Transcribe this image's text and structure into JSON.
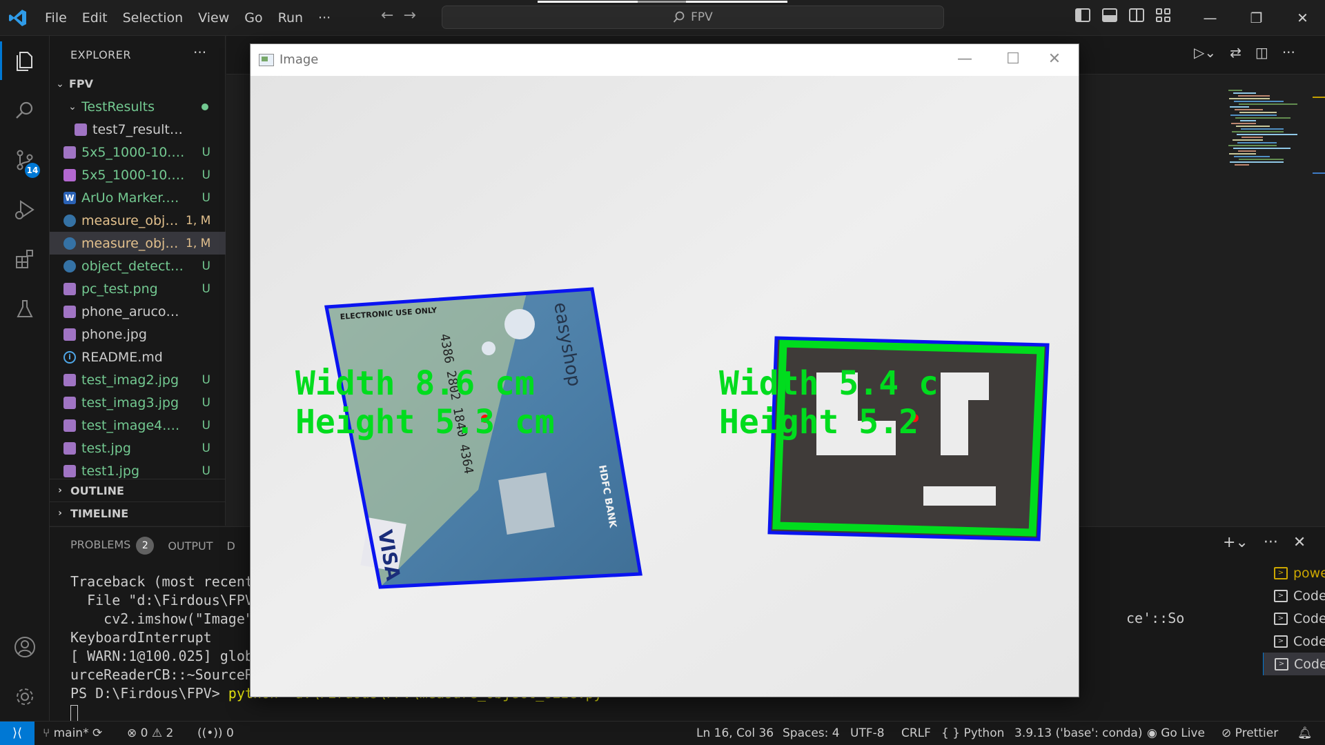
{
  "menu": [
    "File",
    "Edit",
    "Selection",
    "View",
    "Go",
    "Run",
    "···"
  ],
  "search": {
    "text": "FPV"
  },
  "activity": {
    "scm_badge": "14"
  },
  "explorer": {
    "title": "EXPLORER",
    "more": "···",
    "root": "FPV",
    "folder": "TestResults",
    "items": [
      {
        "name": "test7_result.png",
        "status": "",
        "type": "img",
        "color": "white",
        "indent": 2
      },
      {
        "name": "5x5_1000-10.png",
        "status": "U",
        "type": "img",
        "color": "green",
        "indent": 1
      },
      {
        "name": "5x5_1000-10.svg",
        "status": "U",
        "type": "svg",
        "color": "green",
        "indent": 1
      },
      {
        "name": "ArUo Marker.docx",
        "status": "U",
        "type": "doc",
        "color": "green",
        "indent": 1
      },
      {
        "name": "measure_obje...",
        "status": "1, M",
        "type": "py",
        "color": "yellow",
        "indent": 1
      },
      {
        "name": "measure_obje...",
        "status": "1, M",
        "type": "py",
        "color": "yellow",
        "indent": 1
      },
      {
        "name": "object_detector....",
        "status": "U",
        "type": "py",
        "color": "green",
        "indent": 1
      },
      {
        "name": "pc_test.png",
        "status": "U",
        "type": "img",
        "color": "green",
        "indent": 1
      },
      {
        "name": "phone_aruco_marker....",
        "status": "",
        "type": "img",
        "color": "white",
        "indent": 1
      },
      {
        "name": "phone.jpg",
        "status": "",
        "type": "img",
        "color": "white",
        "indent": 1
      },
      {
        "name": "README.md",
        "status": "",
        "type": "info",
        "color": "white",
        "indent": 1
      },
      {
        "name": "test_imag2.jpg",
        "status": "U",
        "type": "img",
        "color": "green",
        "indent": 1
      },
      {
        "name": "test_imag3.jpg",
        "status": "U",
        "type": "img",
        "color": "green",
        "indent": 1
      },
      {
        "name": "test_image4.png",
        "status": "U",
        "type": "img",
        "color": "green",
        "indent": 1
      },
      {
        "name": "test.jpg",
        "status": "U",
        "type": "img",
        "color": "green",
        "indent": 1
      },
      {
        "name": "test1.jpg",
        "status": "U",
        "type": "img",
        "color": "green",
        "indent": 1
      }
    ],
    "outline": "OUTLINE",
    "timeline": "TIMELINE"
  },
  "panel": {
    "problems": "PROBLEMS",
    "problems_count": "2",
    "output": "OUTPUT",
    "debug_partial": "D",
    "terminal_lines": [
      "Traceback (most recent",
      "  File \"d:\\Firdous\\FPV",
      "    cv2.imshow(\"Image\"",
      "KeyboardInterrupt",
      "[ WARN:1@100.025] glob",
      "urceReaderCB::~SourceR"
    ],
    "prompt": "PS D:\\Firdous\\FPV> ",
    "command": "python  d:\\Firdous\\FPV\\measure_object_size.py",
    "right_text": "ce'::So",
    "terminals": [
      {
        "label": "power...",
        "warn": true
      },
      {
        "label": "Code",
        "warn": false
      },
      {
        "label": "Code",
        "warn": false
      },
      {
        "label": "Code",
        "warn": false
      },
      {
        "label": "Code",
        "warn": false,
        "selected": true
      }
    ]
  },
  "status": {
    "branch": "main*",
    "errors": "0",
    "warnings": "2",
    "ports": "0",
    "position": "Ln 16, Col 36",
    "spaces": "Spaces: 4",
    "encoding": "UTF-8",
    "eol": "CRLF",
    "language": "Python",
    "interpreter": "3.9.13 ('base': conda)",
    "golive": "Go Live",
    "prettier": "Prettier"
  },
  "image_window": {
    "title": "Image",
    "overlay": {
      "card_width": "Width 8.6 cm",
      "card_height": "Height 5.3 cm",
      "marker_width": "Width 5.4 c",
      "marker_height": "Height 5.2"
    },
    "card": {
      "header": "ELECTRONIC USE ONLY",
      "brand": "easyshop",
      "number": "4386 2802 1840 4364",
      "bank": "HDFC BANK",
      "network": "VISA"
    }
  },
  "colors": {
    "accent": "#0078d4",
    "git_untracked": "#73c991",
    "git_modified": "#e2c08d",
    "overlay_green": "#00dc1e",
    "box_blue": "#0a14f0"
  }
}
